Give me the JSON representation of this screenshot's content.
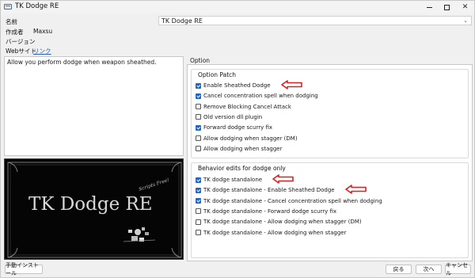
{
  "window": {
    "title": "TK Dodge RE"
  },
  "info": {
    "name_label": "名前",
    "name_value": "TK Dodge RE",
    "author_label": "作成者",
    "author_value": "Maxsu",
    "version_label": "バージョン",
    "website_label": "Webサイト",
    "website_link": "リンク"
  },
  "description": "Allow you perform dodge when weapon sheathed.",
  "preview": {
    "logo_text": "TK Dodge RE",
    "tag_text": "Scripts Free!"
  },
  "options": {
    "header": "Option",
    "groups": [
      {
        "title": "Option Patch",
        "items": [
          {
            "label": "Enable Sheathed Dodge",
            "checked": true,
            "arrow": true
          },
          {
            "label": "Cancel concentration spell when dodging",
            "checked": true,
            "arrow": false
          },
          {
            "label": "Remove Blocking Cancel Attack",
            "checked": false,
            "arrow": false
          },
          {
            "label": "Old version dll plugin",
            "checked": false,
            "arrow": false
          },
          {
            "label": "Forward dodge scurry fix",
            "checked": true,
            "arrow": false
          },
          {
            "label": "Allow dodging when stagger (DM)",
            "checked": false,
            "arrow": false
          },
          {
            "label": "Allow dodging when stagger",
            "checked": false,
            "arrow": false
          }
        ]
      },
      {
        "title": "Behavior edits for dodge only",
        "items": [
          {
            "label": "TK dodge standalone",
            "checked": true,
            "arrow": true
          },
          {
            "label": "TK dodge standalone - Enable Sheathed Dodge",
            "checked": true,
            "arrow": true
          },
          {
            "label": "TK dodge standalone - Cancel concentration spell when dodging",
            "checked": true,
            "arrow": false
          },
          {
            "label": "TK dodge standalone - Forward dodge scurry fix",
            "checked": false,
            "arrow": false
          },
          {
            "label": "TK dodge standalone - Allow dodging when stagger (DM)",
            "checked": false,
            "arrow": false
          },
          {
            "label": "TK dodge standalone - Allow dodging when stagger",
            "checked": false,
            "arrow": false
          }
        ]
      }
    ]
  },
  "buttons": {
    "manual_install": "手動インストール",
    "back": "戻る",
    "next": "次へ",
    "cancel": "キャンセル"
  },
  "colors": {
    "accent": "#1967d2",
    "arrow": "#e02020",
    "link": "#2a5db0"
  }
}
